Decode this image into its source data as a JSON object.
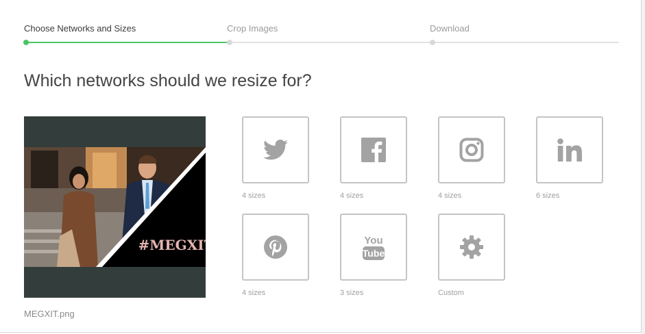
{
  "steps": [
    {
      "label": "Choose Networks and Sizes",
      "active": true
    },
    {
      "label": "Crop Images",
      "active": false
    },
    {
      "label": "Download",
      "active": false
    }
  ],
  "heading": "Which networks should we resize for?",
  "image": {
    "filename": "MEGXIT.png",
    "overlay_text": "#MEGXIT"
  },
  "networks": [
    {
      "name": "Twitter",
      "icon": "twitter-icon",
      "sizes_label": "4 sizes"
    },
    {
      "name": "Facebook",
      "icon": "facebook-icon",
      "sizes_label": "4 sizes"
    },
    {
      "name": "Instagram",
      "icon": "instagram-icon",
      "sizes_label": "4 sizes"
    },
    {
      "name": "LinkedIn",
      "icon": "linkedin-icon",
      "sizes_label": "6 sizes"
    },
    {
      "name": "Pinterest",
      "icon": "pinterest-icon",
      "sizes_label": "4 sizes"
    },
    {
      "name": "YouTube",
      "icon": "youtube-icon",
      "sizes_label": "3 sizes"
    },
    {
      "name": "Custom",
      "icon": "gear-icon",
      "sizes_label": "Custom"
    }
  ],
  "colors": {
    "accent": "#4cc564",
    "icon": "#a3a3a3",
    "tile_border": "#c4c4c4"
  }
}
